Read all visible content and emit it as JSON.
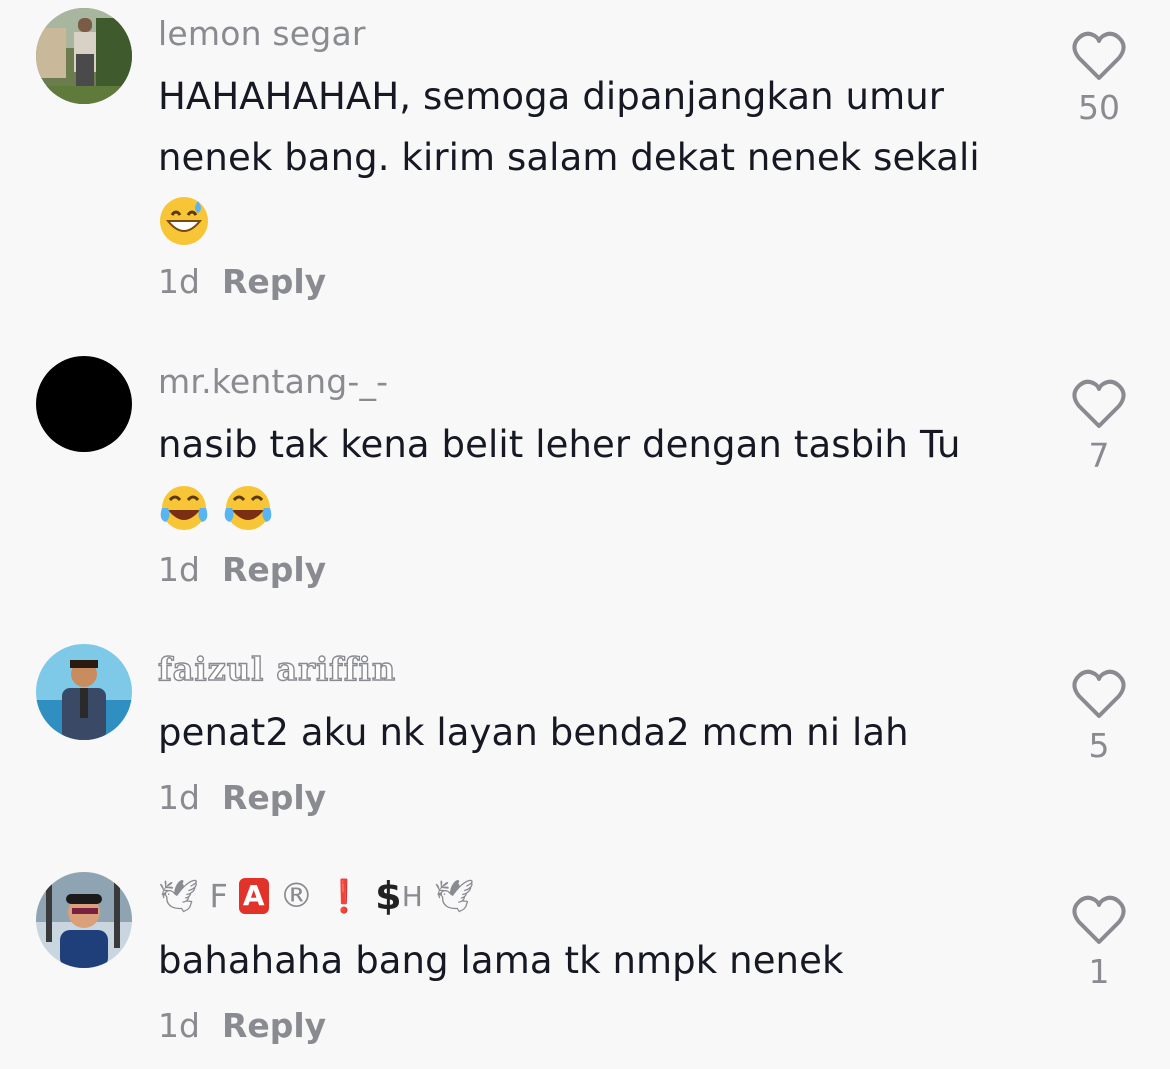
{
  "comments": [
    {
      "username": "lemon segar",
      "text_main": "HAHAHAHAH, semoga dipanjangkan umur nenek bang. kirim salam dekat nenek sekali",
      "emoji": "grinning-sweat-emoji",
      "time": "1d",
      "reply": "Reply",
      "likes": "50"
    },
    {
      "username": "mr.kentang-_-",
      "text_main": "nasib tak kena belit leher dengan tasbih Tu",
      "emoji": "tears-of-joy-emoji",
      "time": "1d",
      "reply": "Reply",
      "likes": "7"
    },
    {
      "username": "faizul ariffin",
      "text_main": "penat2 aku nk layan benda2 mcm ni lah",
      "time": "1d",
      "reply": "Reply",
      "likes": "5"
    },
    {
      "username_parts": {
        "f": "F",
        "a": "A",
        "r": "®",
        "excl": "❗",
        "s": "$",
        "h": "H"
      },
      "text_main": "bahahaha bang lama tk nmpk nenek",
      "time": "1d",
      "reply": "Reply",
      "likes": "1"
    }
  ]
}
